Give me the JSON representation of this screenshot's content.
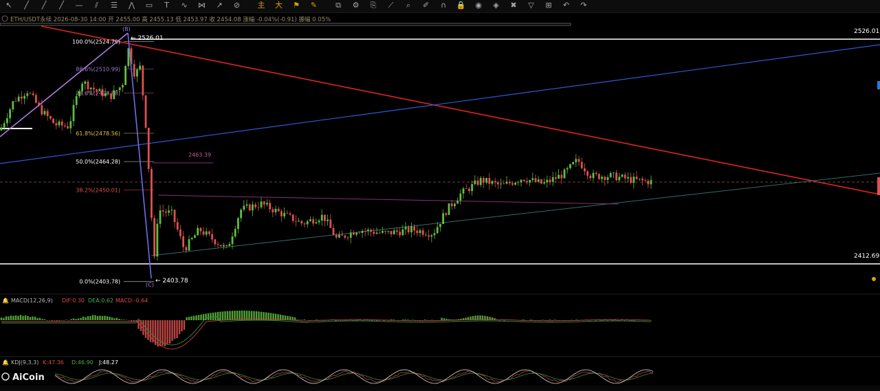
{
  "toolbar": {
    "tools": [
      {
        "name": "cursor-icon",
        "glyph": "↖"
      },
      {
        "name": "trend-line-icon",
        "glyph": "╱"
      },
      {
        "name": "ray-icon",
        "glyph": "╱"
      },
      {
        "name": "extended-line-icon",
        "glyph": "╱"
      },
      {
        "name": "horizontal-line-icon",
        "glyph": "—"
      },
      {
        "name": "parallel-channel-icon",
        "glyph": "⫽"
      },
      {
        "name": "fibonacci-icon",
        "glyph": "☰"
      },
      {
        "name": "pattern-icon",
        "glyph": "⋀"
      },
      {
        "name": "rectangle-icon",
        "glyph": "▭"
      },
      {
        "name": "text-icon",
        "glyph": "T"
      },
      {
        "name": "elliott-wave-icon",
        "glyph": "∿"
      },
      {
        "name": "gann-icon",
        "glyph": "⋈"
      },
      {
        "name": "arrow-icon",
        "glyph": "↗"
      },
      {
        "name": "ruler-icon",
        "glyph": "⊘"
      },
      {
        "name": "main-indicator-icon",
        "glyph": "主",
        "gold": true
      },
      {
        "name": "big-trade-icon",
        "glyph": "大",
        "gold": true
      },
      {
        "name": "signal-icon",
        "glyph": "⚑",
        "gold": true
      },
      {
        "name": "magnet-draw-icon",
        "glyph": "✎",
        "gold": true
      },
      {
        "name": "layout-icon",
        "glyph": "⧉"
      },
      {
        "name": "settings-icon",
        "glyph": "⚙"
      },
      {
        "name": "copy-icon",
        "glyph": "⎘"
      },
      {
        "name": "measure-icon",
        "glyph": "⟋"
      },
      {
        "name": "zoom-icon",
        "glyph": "⌕"
      },
      {
        "name": "brush-icon",
        "glyph": "✐"
      },
      {
        "name": "magnet-icon",
        "glyph": "∩"
      },
      {
        "name": "lock-icon",
        "glyph": "🔒"
      },
      {
        "name": "eye-icon",
        "glyph": "◉"
      },
      {
        "name": "alert-icon",
        "glyph": "◈"
      },
      {
        "name": "delete-icon",
        "glyph": "✖"
      },
      {
        "name": "filter-icon",
        "glyph": "▽"
      },
      {
        "name": "hide-icon",
        "glyph": "⊞"
      },
      {
        "name": "undo-icon",
        "glyph": "↶"
      },
      {
        "name": "redo-icon",
        "glyph": "↷"
      }
    ]
  },
  "info_bar": {
    "text": "ETH/USDT永续  2026-08-30 14:00  开 2455.00  高 2455.13  低 2453.97  收 2454.08  涨幅 -0.04%(-0.91)  振幅 0.05%"
  },
  "price_labels": {
    "top_right": "2526.01",
    "bottom_right": "2412.69",
    "high_marker": "← 2526.01",
    "low_marker": "← 2403.78",
    "mid_level": "2463.39"
  },
  "wave_labels": {
    "b": "(B)",
    "c": "(C)"
  },
  "fib_levels": [
    {
      "label": "100.0%(2524.79)",
      "color": "#ffffff",
      "price": 2524.79
    },
    {
      "label": "88.6%(2510.99)",
      "color": "#9b7bd8",
      "price": 2510.99
    },
    {
      "label": "78.6%(2498.88)",
      "color": "#d07ac8",
      "price": 2498.88
    },
    {
      "label": "61.8%(2478.56)",
      "color": "#e0c23a",
      "price": 2478.56
    },
    {
      "label": "50.0%(2464.28)",
      "color": "#ffffff",
      "price": 2464.28
    },
    {
      "label": "38.2%(2450.01)",
      "color": "#e05050",
      "price": 2450.01
    },
    {
      "label": "0.0%(2403.78)",
      "color": "#ffffff",
      "price": 2403.78
    }
  ],
  "macd": {
    "name": "MACD(12,26,9)",
    "dif": "DIF:0.30",
    "dea": "DEA:0.62",
    "macd": "MACD:-0.64",
    "colors": {
      "dif": "#e04848",
      "dea": "#4caf50",
      "macd": "#e04848"
    }
  },
  "kdj": {
    "name": "KDJ(9,3,3)",
    "k": "K:47.36",
    "d": "D:46.90",
    "j": "J:48.27",
    "colors": {
      "k": "#e04848",
      "d": "#4caf50",
      "j": "#ffffff"
    }
  },
  "watermark": "AiCoin",
  "colors": {
    "up": "#5fbf3f",
    "down": "#e05050",
    "background": "#000000",
    "red_trendline": "#e02424",
    "blue_trendline": "#2a5bd8",
    "teal_line": "#2f6f6a"
  }
}
